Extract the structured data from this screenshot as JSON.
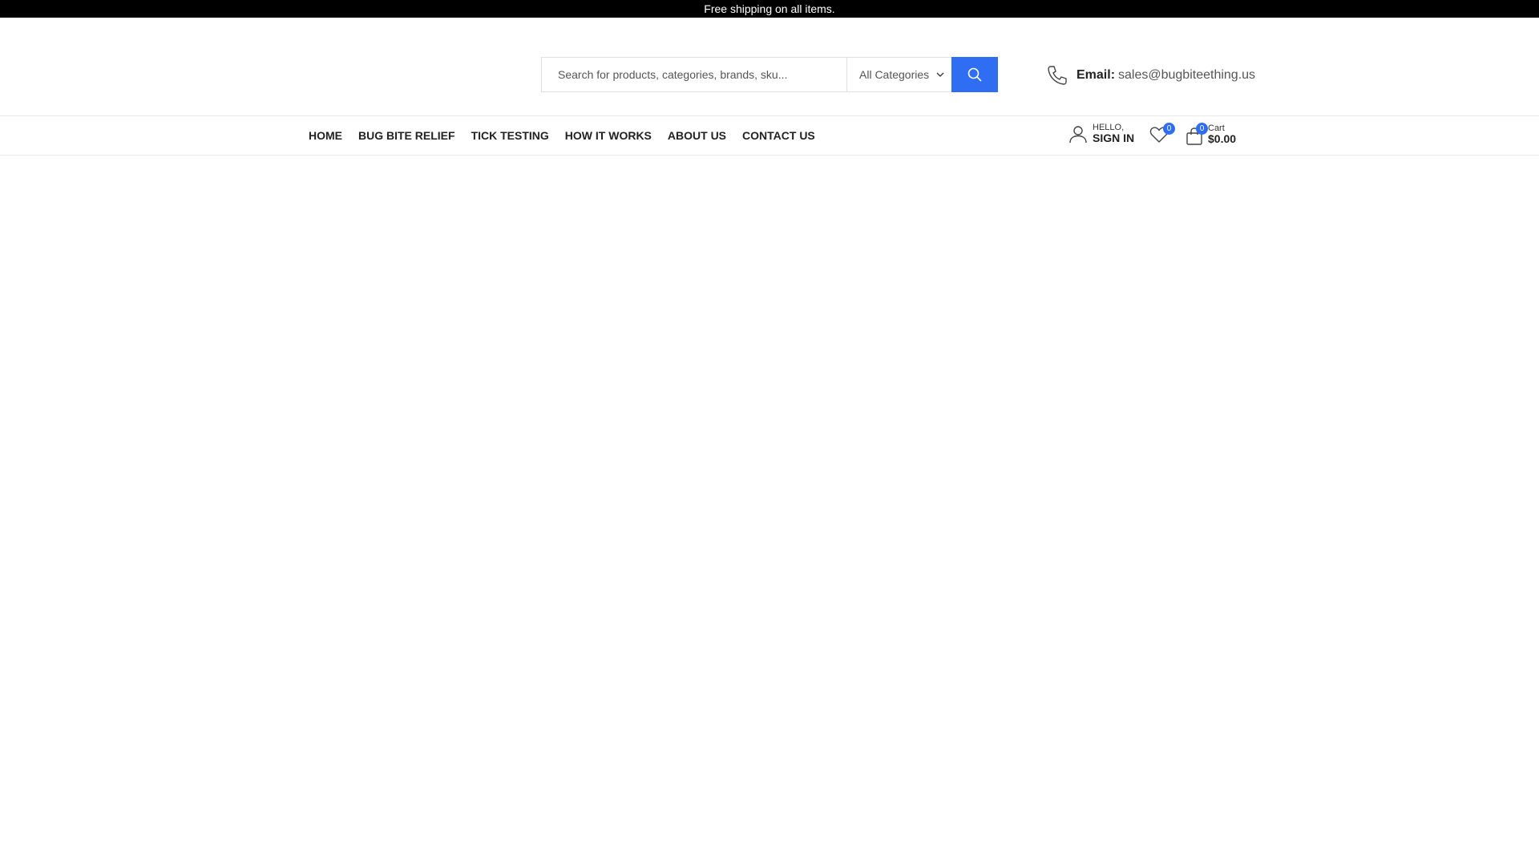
{
  "topbar": {
    "message": "Free shipping on all items."
  },
  "search": {
    "placeholder": "Search for products, categories, brands, sku...",
    "category_selected": "All Categories"
  },
  "contact": {
    "label": "Email:",
    "value": "sales@bugbiteething.us"
  },
  "nav": {
    "items": [
      {
        "label": "HOME"
      },
      {
        "label": "BUG BITE RELIEF"
      },
      {
        "label": "TICK TESTING"
      },
      {
        "label": "HOW IT WORKS"
      },
      {
        "label": "ABOUT US"
      },
      {
        "label": "CONTACT US"
      }
    ]
  },
  "account": {
    "greeting": "HELLO,",
    "action": "SIGN IN"
  },
  "wishlist": {
    "count": "0"
  },
  "cart": {
    "count": "0",
    "label": "Cart",
    "total": "$0.00"
  },
  "colors": {
    "accent": "#2f6df3",
    "topbar_bg": "#000000"
  },
  "icons": [
    "search-icon",
    "chevron-down-icon",
    "phone-icon",
    "user-icon",
    "heart-icon",
    "shopping-bag-icon"
  ]
}
